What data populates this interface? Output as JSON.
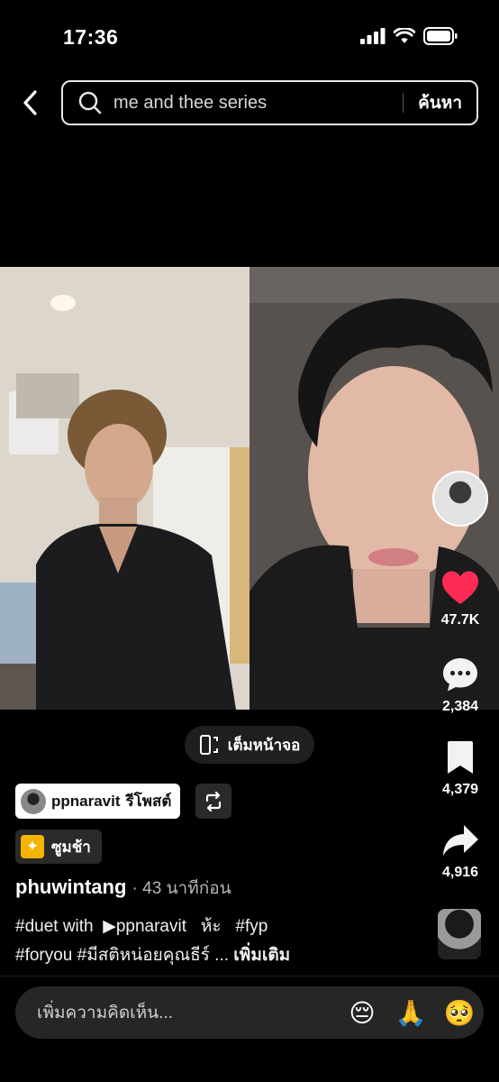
{
  "status_bar": {
    "time": "17:36"
  },
  "search": {
    "query": "me and thee series",
    "submit_label": "ค้นหา"
  },
  "video": {
    "fullscreen_label": "เต็มหน้าจอ"
  },
  "actions": {
    "likes": "47.7K",
    "comments": "2,384",
    "bookmarks": "4,379",
    "shares": "4,916"
  },
  "repost": {
    "user": "ppnaravit",
    "label": "รีโพสต์"
  },
  "zoom": {
    "label": "ซูมช้า"
  },
  "post": {
    "author": "phuwintang",
    "time_ago": "43 นาทีก่อน",
    "caption_line1_a": "#duet with",
    "caption_mention": "ppnaravit",
    "caption_line1_b": "ห้ะ",
    "caption_tag_fyp": "#fyp",
    "caption_line2_a": "#foryou",
    "caption_line2_b": "#มีสติหน่อยคุณธีร์",
    "caption_ellipsis": "...",
    "more_label": "เพิ่มเติม"
  },
  "comment": {
    "placeholder": "เพิ่มความคิดเห็น...",
    "emojis": [
      "😔",
      "🙏",
      "🥺"
    ]
  },
  "colors": {
    "like_red": "#fe2c55",
    "background": "#000000"
  }
}
